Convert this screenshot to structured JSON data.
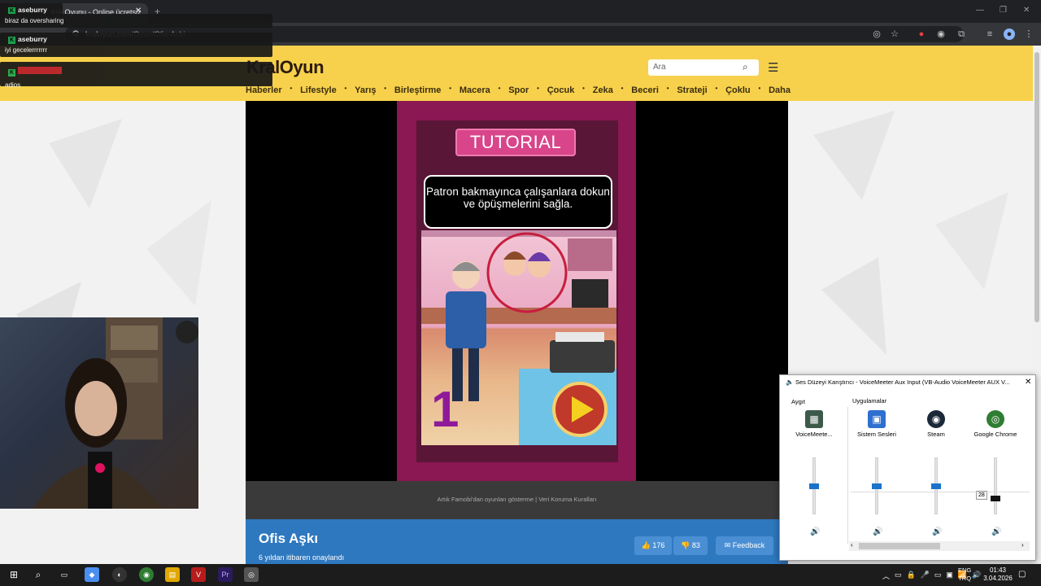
{
  "browser": {
    "tab_title": "Aşk Oyunu - Online ücretsiz",
    "new_tab_icon": "+",
    "url_host": "kraloyun.com",
    "url_path": "/Oyun/Ofis-Aski"
  },
  "chat_overlay": {
    "messages": [
      {
        "user": "aseburry",
        "text": "biraz da oversharing"
      },
      {
        "user": "aseburry",
        "text": "iyi gecelerrrrrrr"
      },
      {
        "user": "",
        "text": "adios"
      }
    ]
  },
  "site": {
    "logo": "KralOyun",
    "search_placeholder": "Ara",
    "nav": [
      "Haberler",
      "Lifestyle",
      "Yarış",
      "Birleştirme",
      "Macera",
      "Spor",
      "Çocuk",
      "Zeka",
      "Beceri",
      "Strateji",
      "Çoklu",
      "Daha"
    ]
  },
  "game": {
    "tutorial_label": "TUTORIAL",
    "instruction": "Patron bakmayınca çalışanlara dokun ve öpüşmelerini sağla.",
    "step_number": "1",
    "footer_text": "Artık Famobi'dan oyunları gösterme | Veri Koruma Kuralları",
    "title": "Ofis Aşkı",
    "approved": "6 yıldan itibaren onaylandı",
    "likes": "176",
    "dislikes": "83",
    "feedback_label": "Feedback"
  },
  "mixer": {
    "title": "Ses Düzeyi Karıştırıcı - VoiceMeeter Aux Input (VB-Audio VoiceMeeter AUX V...",
    "device_label": "Aygıt",
    "apps_label": "Uygulamalar",
    "channels": [
      {
        "name": "VoiceMeete...",
        "level": 0.5
      },
      {
        "name": "Sistem Sesleri",
        "level": 0.5
      },
      {
        "name": "Steam",
        "level": 0.5
      },
      {
        "name": "Google Chrome",
        "level": 0.28,
        "tooltip": "28"
      }
    ]
  },
  "taskbar": {
    "lang_top": "ENG",
    "lang_bottom": "TRQ",
    "time": "01:43",
    "date": "3.04.2026"
  },
  "colors": {
    "site_header": "#f7d14b",
    "info_bar": "#2e78bf",
    "game_frame": "#8b1753",
    "tutorial": "#d8458a"
  }
}
